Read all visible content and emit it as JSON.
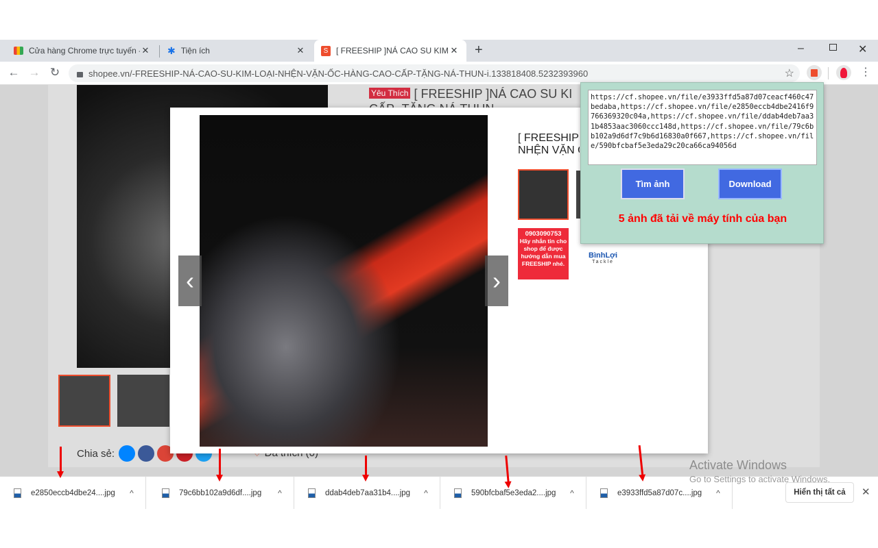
{
  "browser": {
    "tabs": [
      {
        "label": "Cửa hàng Chrome trực tuyến - dữ",
        "icon": "chrome-webstore-icon"
      },
      {
        "label": "Tiện ích",
        "icon": "puzzle-icon"
      },
      {
        "label": "[ FREESHIP ]NÁ CAO SU KIM LOẠI",
        "icon": "shopee-icon",
        "active": true
      }
    ],
    "url": "shopee.vn/-FREESHIP-NÁ-CAO-SU-KIM-LOẠI-NHỆN-VẶN-ỐC-HÀNG-CAO-CẤP-TẶNG-NÁ-THUN-i.133818408.5232393960"
  },
  "product": {
    "badge": "Yêu Thích",
    "title_line1": "[ FREESHIP ]NÁ CAO SU KI",
    "title_line2": "CẤP- TẶNG NÁ THUN",
    "share_label": "Chia sẻ:",
    "like_label": "Đã thích (0)"
  },
  "modal": {
    "title_line1": "[ FREESHIP",
    "title_line2": "NHỆN VẶN Ố",
    "banner_phone": "0903090753",
    "banner_text": "Hãy nhắn tin cho shop để được hướng dẫn mua FREESHIP nhé.",
    "logo_text": "BìnhLợi",
    "logo_sub": "Tackle"
  },
  "extension": {
    "urls": "https://cf.shopee.vn/file/e3933ffd5a87d07ceacf460c47bedaba,https://cf.shopee.vn/file/e2850eccb4dbe2416f9766369320c04a,https://cf.shopee.vn/file/ddab4deb7aa31b4853aac3060ccc148d,https://cf.shopee.vn/file/79c6bb102a9d6df7c9b6d16830a0f667,https://cf.shopee.vn/file/590bfcbaf5e3eda29c20ca66ca94056d",
    "find_button": "Tìm ảnh",
    "download_button": "Download",
    "status": "5 ảnh đã tải về máy tính của bạn",
    "bg_color": "#b5dccd",
    "button_color": "#4169e1",
    "status_color": "#ff0000"
  },
  "downloads": {
    "items": [
      "e2850eccb4dbe24....jpg",
      "79c6bb102a9d6df....jpg",
      "ddab4deb7aa31b4....jpg",
      "590bfcbaf5e3eda2....jpg",
      "e3933ffd5a87d07c....jpg"
    ],
    "show_all": "Hiển thị tất cả"
  },
  "watermark": {
    "line1": "Activate Windows",
    "line2": "Go to Settings to activate Windows."
  }
}
